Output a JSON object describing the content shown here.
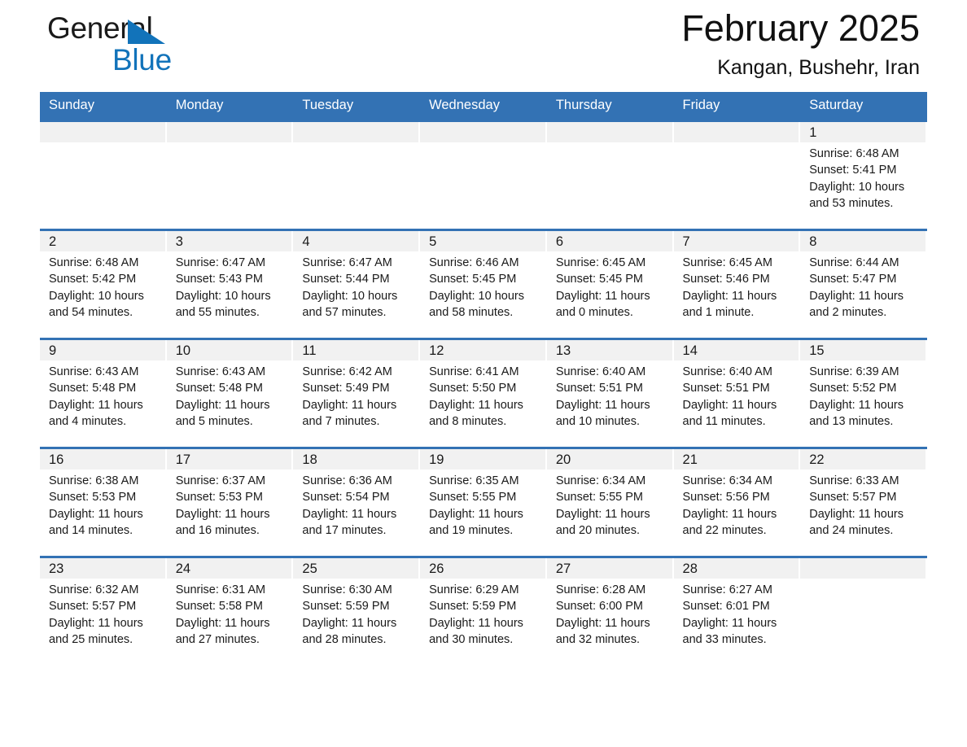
{
  "brand": {
    "word1": "General",
    "word2": "Blue",
    "triangle_color": "#1273ba",
    "triangle_icon": "brand-triangle-icon"
  },
  "header": {
    "month_title": "February 2025",
    "location": "Kangan, Bushehr, Iran"
  },
  "theme": {
    "header_blue": "#3372b4",
    "daynum_band": "#f1f1f1",
    "text": "#1a1a1a",
    "brand_blue": "#1273ba"
  },
  "weekday_headers": [
    "Sunday",
    "Monday",
    "Tuesday",
    "Wednesday",
    "Thursday",
    "Friday",
    "Saturday"
  ],
  "weeks": [
    [
      {
        "day": "",
        "blank": true
      },
      {
        "day": "",
        "blank": true
      },
      {
        "day": "",
        "blank": true
      },
      {
        "day": "",
        "blank": true
      },
      {
        "day": "",
        "blank": true
      },
      {
        "day": "",
        "blank": true
      },
      {
        "day": "1",
        "sunrise": "Sunrise: 6:48 AM",
        "sunset": "Sunset: 5:41 PM",
        "daylight": "Daylight: 10 hours and 53 minutes."
      }
    ],
    [
      {
        "day": "2",
        "sunrise": "Sunrise: 6:48 AM",
        "sunset": "Sunset: 5:42 PM",
        "daylight": "Daylight: 10 hours and 54 minutes."
      },
      {
        "day": "3",
        "sunrise": "Sunrise: 6:47 AM",
        "sunset": "Sunset: 5:43 PM",
        "daylight": "Daylight: 10 hours and 55 minutes."
      },
      {
        "day": "4",
        "sunrise": "Sunrise: 6:47 AM",
        "sunset": "Sunset: 5:44 PM",
        "daylight": "Daylight: 10 hours and 57 minutes."
      },
      {
        "day": "5",
        "sunrise": "Sunrise: 6:46 AM",
        "sunset": "Sunset: 5:45 PM",
        "daylight": "Daylight: 10 hours and 58 minutes."
      },
      {
        "day": "6",
        "sunrise": "Sunrise: 6:45 AM",
        "sunset": "Sunset: 5:45 PM",
        "daylight": "Daylight: 11 hours and 0 minutes."
      },
      {
        "day": "7",
        "sunrise": "Sunrise: 6:45 AM",
        "sunset": "Sunset: 5:46 PM",
        "daylight": "Daylight: 11 hours and 1 minute."
      },
      {
        "day": "8",
        "sunrise": "Sunrise: 6:44 AM",
        "sunset": "Sunset: 5:47 PM",
        "daylight": "Daylight: 11 hours and 2 minutes."
      }
    ],
    [
      {
        "day": "9",
        "sunrise": "Sunrise: 6:43 AM",
        "sunset": "Sunset: 5:48 PM",
        "daylight": "Daylight: 11 hours and 4 minutes."
      },
      {
        "day": "10",
        "sunrise": "Sunrise: 6:43 AM",
        "sunset": "Sunset: 5:48 PM",
        "daylight": "Daylight: 11 hours and 5 minutes."
      },
      {
        "day": "11",
        "sunrise": "Sunrise: 6:42 AM",
        "sunset": "Sunset: 5:49 PM",
        "daylight": "Daylight: 11 hours and 7 minutes."
      },
      {
        "day": "12",
        "sunrise": "Sunrise: 6:41 AM",
        "sunset": "Sunset: 5:50 PM",
        "daylight": "Daylight: 11 hours and 8 minutes."
      },
      {
        "day": "13",
        "sunrise": "Sunrise: 6:40 AM",
        "sunset": "Sunset: 5:51 PM",
        "daylight": "Daylight: 11 hours and 10 minutes."
      },
      {
        "day": "14",
        "sunrise": "Sunrise: 6:40 AM",
        "sunset": "Sunset: 5:51 PM",
        "daylight": "Daylight: 11 hours and 11 minutes."
      },
      {
        "day": "15",
        "sunrise": "Sunrise: 6:39 AM",
        "sunset": "Sunset: 5:52 PM",
        "daylight": "Daylight: 11 hours and 13 minutes."
      }
    ],
    [
      {
        "day": "16",
        "sunrise": "Sunrise: 6:38 AM",
        "sunset": "Sunset: 5:53 PM",
        "daylight": "Daylight: 11 hours and 14 minutes."
      },
      {
        "day": "17",
        "sunrise": "Sunrise: 6:37 AM",
        "sunset": "Sunset: 5:53 PM",
        "daylight": "Daylight: 11 hours and 16 minutes."
      },
      {
        "day": "18",
        "sunrise": "Sunrise: 6:36 AM",
        "sunset": "Sunset: 5:54 PM",
        "daylight": "Daylight: 11 hours and 17 minutes."
      },
      {
        "day": "19",
        "sunrise": "Sunrise: 6:35 AM",
        "sunset": "Sunset: 5:55 PM",
        "daylight": "Daylight: 11 hours and 19 minutes."
      },
      {
        "day": "20",
        "sunrise": "Sunrise: 6:34 AM",
        "sunset": "Sunset: 5:55 PM",
        "daylight": "Daylight: 11 hours and 20 minutes."
      },
      {
        "day": "21",
        "sunrise": "Sunrise: 6:34 AM",
        "sunset": "Sunset: 5:56 PM",
        "daylight": "Daylight: 11 hours and 22 minutes."
      },
      {
        "day": "22",
        "sunrise": "Sunrise: 6:33 AM",
        "sunset": "Sunset: 5:57 PM",
        "daylight": "Daylight: 11 hours and 24 minutes."
      }
    ],
    [
      {
        "day": "23",
        "sunrise": "Sunrise: 6:32 AM",
        "sunset": "Sunset: 5:57 PM",
        "daylight": "Daylight: 11 hours and 25 minutes."
      },
      {
        "day": "24",
        "sunrise": "Sunrise: 6:31 AM",
        "sunset": "Sunset: 5:58 PM",
        "daylight": "Daylight: 11 hours and 27 minutes."
      },
      {
        "day": "25",
        "sunrise": "Sunrise: 6:30 AM",
        "sunset": "Sunset: 5:59 PM",
        "daylight": "Daylight: 11 hours and 28 minutes."
      },
      {
        "day": "26",
        "sunrise": "Sunrise: 6:29 AM",
        "sunset": "Sunset: 5:59 PM",
        "daylight": "Daylight: 11 hours and 30 minutes."
      },
      {
        "day": "27",
        "sunrise": "Sunrise: 6:28 AM",
        "sunset": "Sunset: 6:00 PM",
        "daylight": "Daylight: 11 hours and 32 minutes."
      },
      {
        "day": "28",
        "sunrise": "Sunrise: 6:27 AM",
        "sunset": "Sunset: 6:01 PM",
        "daylight": "Daylight: 11 hours and 33 minutes."
      },
      {
        "day": "",
        "blank": true
      }
    ]
  ]
}
